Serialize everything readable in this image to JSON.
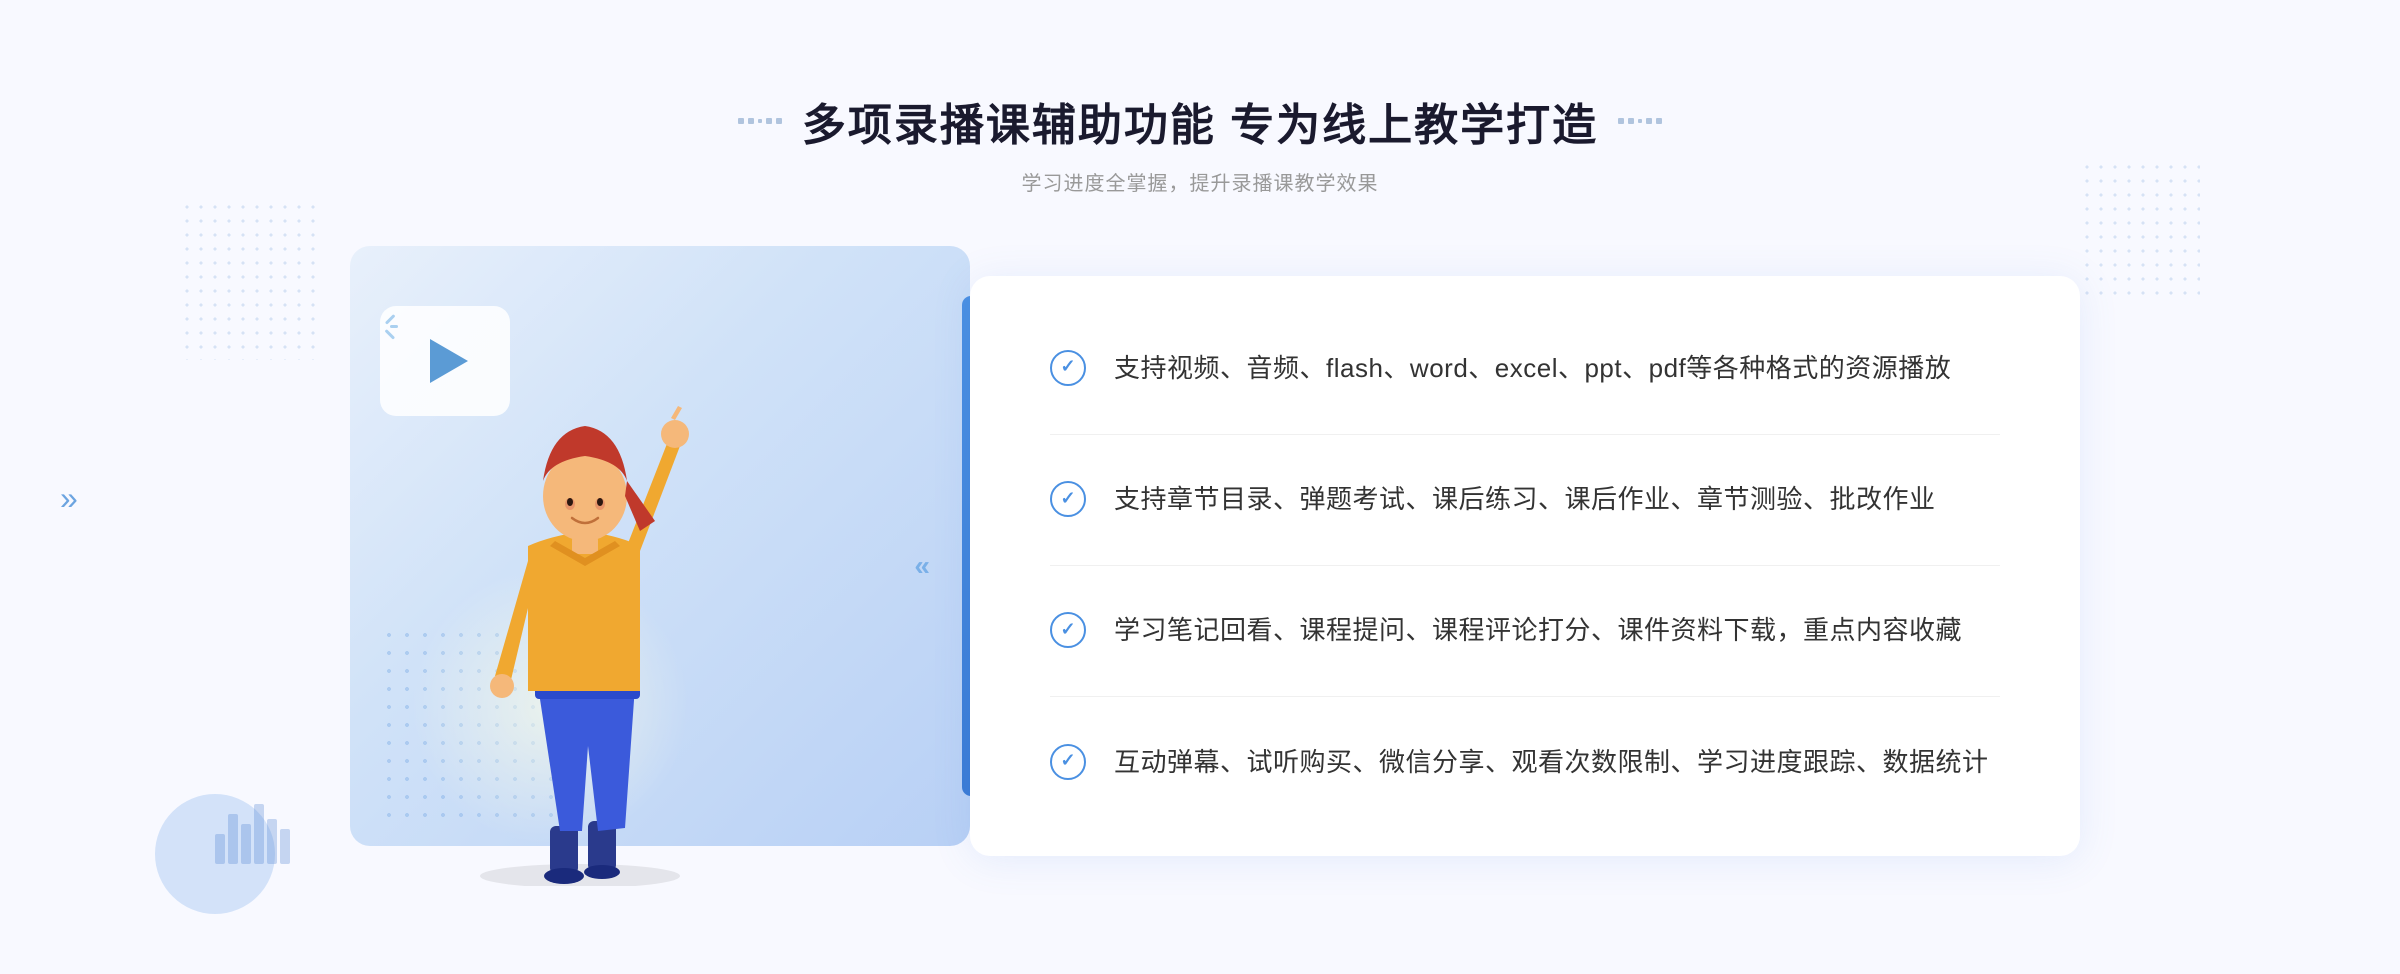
{
  "header": {
    "title": "多项录播课辅助功能 专为线上教学打造",
    "subtitle": "学习进度全掌握，提升录播课教学效果",
    "title_deco_left": "··",
    "title_deco_right": "··"
  },
  "features": [
    {
      "id": "feature-1",
      "text": "支持视频、音频、flash、word、excel、ppt、pdf等各种格式的资源播放"
    },
    {
      "id": "feature-2",
      "text": "支持章节目录、弹题考试、课后练习、课后作业、章节测验、批改作业"
    },
    {
      "id": "feature-3",
      "text": "学习笔记回看、课程提问、课程评论打分、课件资料下载，重点内容收藏"
    },
    {
      "id": "feature-4",
      "text": "互动弹幕、试听购买、微信分享、观看次数限制、学习进度跟踪、数据统计"
    }
  ],
  "decoration": {
    "arrow_left": "»",
    "arrow_illus": "«"
  },
  "colors": {
    "primary_blue": "#4a90e2",
    "light_blue_bg": "#e8f1fb",
    "text_dark": "#1a1a2e",
    "text_gray": "#999999",
    "text_body": "#333333"
  }
}
